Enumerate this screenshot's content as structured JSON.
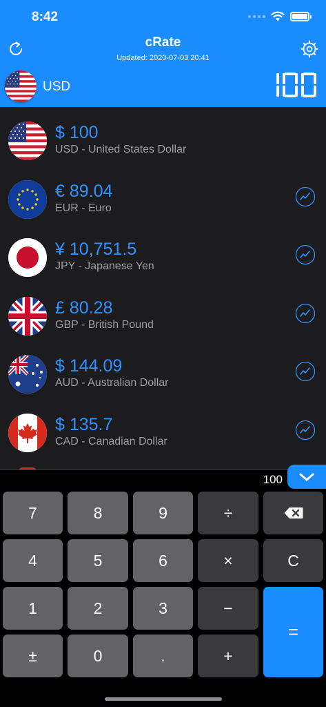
{
  "status_bar": {
    "time": "8:42"
  },
  "header": {
    "title": "cRate",
    "updated": "Updated: 2020-07-03 20:41",
    "base_currency": "USD",
    "base_amount": "100"
  },
  "rates": [
    {
      "code": "USD",
      "amount": "$ 100",
      "label": "USD - United States Dollar",
      "flag": "us-flag-icon",
      "chart": false
    },
    {
      "code": "EUR",
      "amount": "€ 89.04",
      "label": "EUR - Euro",
      "flag": "eu-flag-icon",
      "chart": true
    },
    {
      "code": "JPY",
      "amount": "¥ 10,751.5",
      "label": "JPY - Japanese Yen",
      "flag": "jp-flag-icon",
      "chart": true
    },
    {
      "code": "GBP",
      "amount": "£ 80.28",
      "label": "GBP - British Pound",
      "flag": "gb-flag-icon",
      "chart": true
    },
    {
      "code": "AUD",
      "amount": "$ 144.09",
      "label": "AUD - Australian Dollar",
      "flag": "au-flag-icon",
      "chart": true
    },
    {
      "code": "CAD",
      "amount": "$ 135.7",
      "label": "CAD - Canadian Dollar",
      "flag": "ca-flag-icon",
      "chart": true
    }
  ],
  "calculator": {
    "display": "100",
    "keys": {
      "k7": "7",
      "k8": "8",
      "k9": "9",
      "div": "÷",
      "k4": "4",
      "k5": "5",
      "k6": "6",
      "mul": "×",
      "clear": "C",
      "k1": "1",
      "k2": "2",
      "k3": "3",
      "minus": "−",
      "sign": "±",
      "k0": "0",
      "dot": ".",
      "plus": "+",
      "equals": "="
    }
  },
  "colors": {
    "accent": "#1a8cff",
    "amount": "#2f93ff",
    "list_bg": "#1c1c1e",
    "number_key": "#636366",
    "operator_key": "#3a3a3c"
  }
}
